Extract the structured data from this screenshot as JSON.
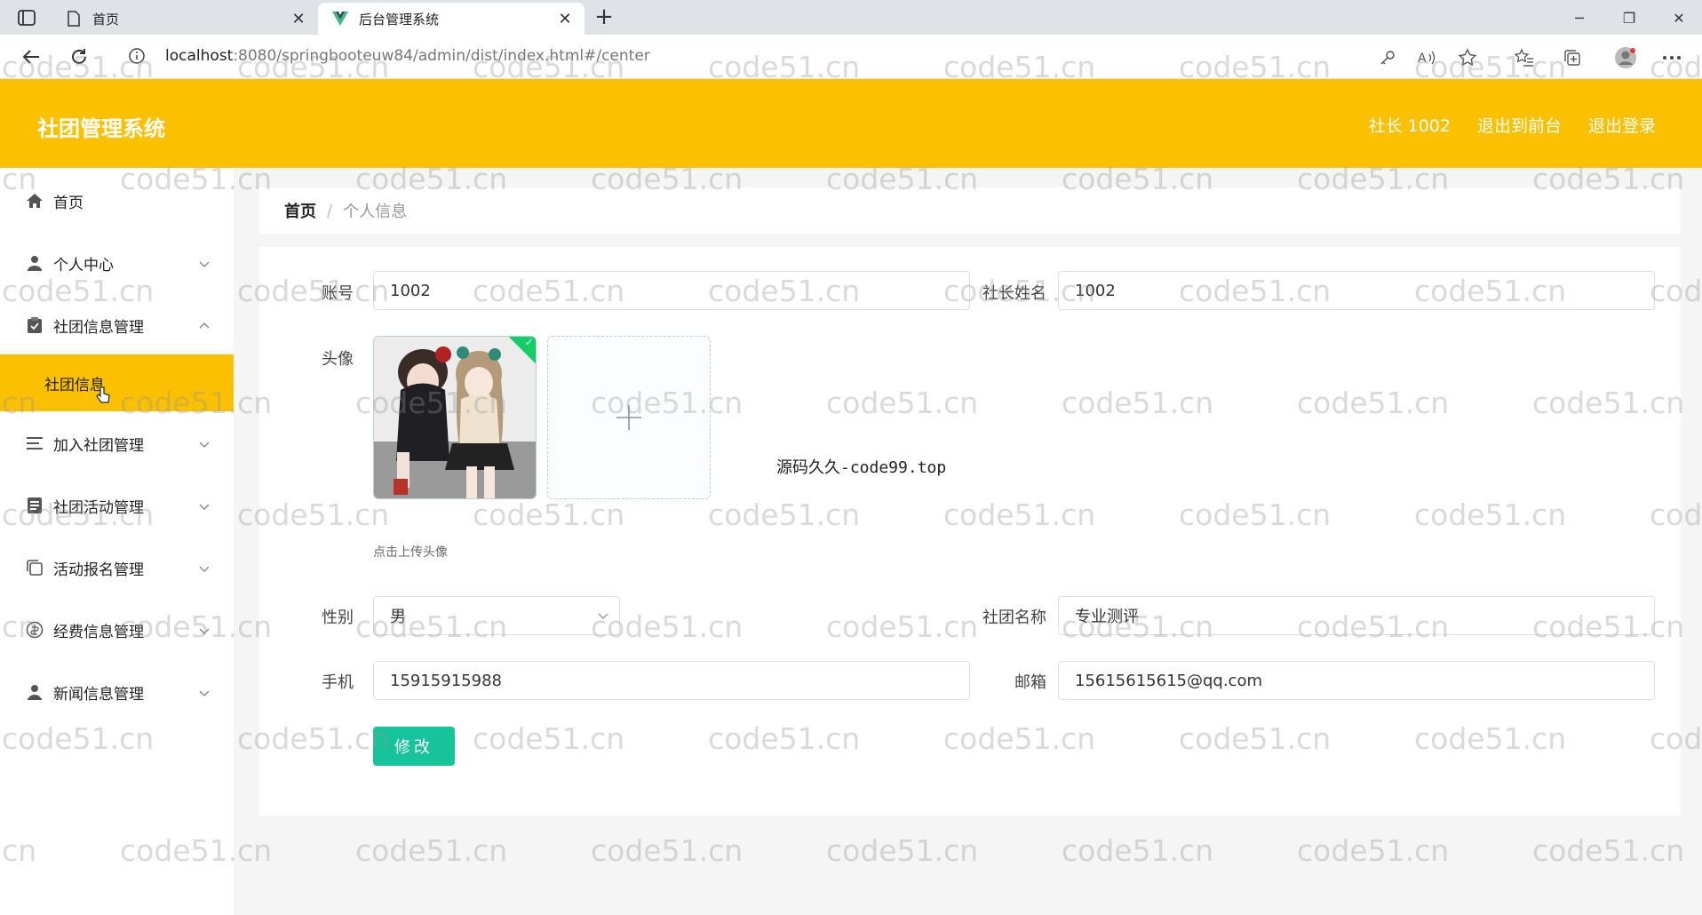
{
  "browser": {
    "tabs": [
      {
        "title": "首页",
        "icon": "page-icon"
      },
      {
        "title": "后台管理系统",
        "icon": "vue-logo-icon"
      }
    ],
    "url_host": "localhost",
    "url_rest": ":8080/springbooteuw84/admin/dist/index.html#/center"
  },
  "header": {
    "title": "社团管理系统",
    "user": "社长 1002",
    "to_front": "退出到前台",
    "logout": "退出登录"
  },
  "sidebar": {
    "items": [
      {
        "label": "首页",
        "icon": "home-icon"
      },
      {
        "label": "个人中心",
        "icon": "user-icon"
      },
      {
        "label": "社团信息管理",
        "icon": "clipboard-icon"
      },
      {
        "label": "社团信息",
        "icon": ""
      },
      {
        "label": "加入社团管理",
        "icon": "list-icon"
      },
      {
        "label": "社团活动管理",
        "icon": "document-icon"
      },
      {
        "label": "活动报名管理",
        "icon": "copy-icon"
      },
      {
        "label": "经费信息管理",
        "icon": "money-icon"
      },
      {
        "label": "新闻信息管理",
        "icon": "person-icon"
      }
    ]
  },
  "breadcrumb": {
    "home": "首页",
    "separator": "/",
    "current": "个人信息"
  },
  "form": {
    "account_label": "账号",
    "account_value": "1002",
    "leader_name_label": "社长姓名",
    "leader_name_value": "1002",
    "avatar_label": "头像",
    "upload_tip": "点击上传头像",
    "source_note": "源码久久-code99.top",
    "gender_label": "性别",
    "gender_value": "男",
    "club_name_label": "社团名称",
    "club_name_value": "专业测评",
    "phone_label": "手机",
    "phone_value": "15915915988",
    "email_label": "邮箱",
    "email_value": "15615615615@qq.com",
    "submit_label": "修改"
  },
  "watermark": "code51.cn",
  "colors": {
    "header": "#fbc000",
    "submit": "#16c39a",
    "upload_success": "#13ce66"
  }
}
